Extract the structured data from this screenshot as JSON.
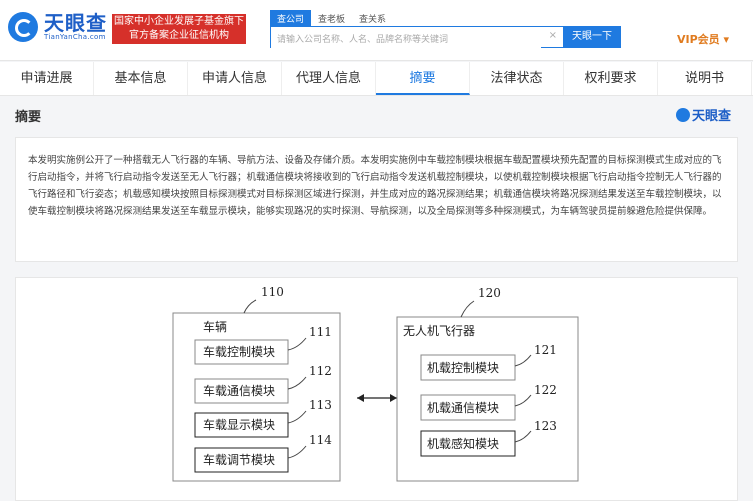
{
  "header": {
    "logo_cn": "天眼查",
    "logo_en": "TianYanCha.com",
    "banner_line1": "国家中小企业发展子基金旗下",
    "banner_line2": "官方备案企业征信机构",
    "search_tabs": [
      "查公司",
      "查老板",
      "查关系"
    ],
    "search_placeholder": "请输入公司名称、人名、品牌名称等关键词",
    "search_button": "天眼一下",
    "vip_label": "VIP会员 ▾"
  },
  "nav": {
    "tabs": [
      "申请进展",
      "基本信息",
      "申请人信息",
      "代理人信息",
      "摘要",
      "法律状态",
      "权利要求",
      "说明书"
    ],
    "active": "摘要"
  },
  "section": {
    "title": "摘要",
    "watermark": "天眼查"
  },
  "abstract": {
    "text": "本发明实施例公开了一种搭载无人飞行器的车辆、导航方法、设备及存储介质。本发明实施例中车载控制模块根据车载配置模块预先配置的目标探测模式生成对应的飞行启动指令，并将飞行启动指令发送至无人飞行器；机载通信模块将接收到的飞行启动指令发送机载控制模块，以使机载控制模块根据飞行启动指令控制无人飞行器的飞行路径和飞行姿态；机载感知模块按照目标探测模式对目标探测区域进行探测，并生成对应的路况探测结果；机载通信模块将路况探测结果发送至车载控制模块，以使车载控制模块将路况探测结果发送至车载显示模块，能够实现路况的实时探测、导航探测，以及全局探测等多种探测模式，为车辆驾驶员提前躲避危险提供保障。"
  },
  "figure": {
    "vehicle": {
      "ref": "110",
      "label": "车辆",
      "modules": [
        {
          "label": "车载控制模块",
          "ref": "111"
        },
        {
          "label": "车载通信模块",
          "ref": "112"
        },
        {
          "label": "车载显示模块",
          "ref": "113"
        },
        {
          "label": "车载调节模块",
          "ref": "114"
        }
      ]
    },
    "uav": {
      "ref": "120",
      "label": "无人机飞行器",
      "modules": [
        {
          "label": "机载控制模块",
          "ref": "121"
        },
        {
          "label": "机载通信模块",
          "ref": "122"
        },
        {
          "label": "机载感知模块",
          "ref": "123"
        }
      ]
    }
  },
  "colors": {
    "brand": "#1f7ae0",
    "banner": "#d6302a",
    "vip": "#e07b1f"
  }
}
